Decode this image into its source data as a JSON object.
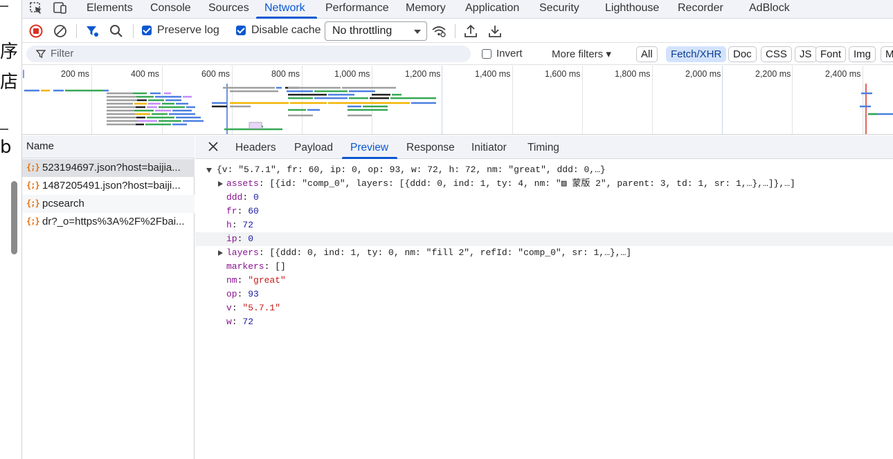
{
  "main_tabs": [
    "Elements",
    "Console",
    "Sources",
    "Network",
    "Performance",
    "Memory",
    "Application",
    "Security",
    "Lighthouse",
    "Recorder",
    "AdBlock"
  ],
  "active_main_tab": "Network",
  "toolbar": {
    "preserve_log": "Preserve log",
    "disable_cache": "Disable cache",
    "throttling": "No throttling"
  },
  "filter": {
    "placeholder": "Filter",
    "invert": "Invert",
    "more_filters": "More filters ▾",
    "types": [
      "All",
      "Fetch/XHR",
      "Doc",
      "CSS",
      "JS",
      "Font",
      "Img",
      "M"
    ],
    "active_type": "Fetch/XHR"
  },
  "timeline": {
    "ticks": [
      "200 ms",
      "400 ms",
      "600 ms",
      "800 ms",
      "1,000 ms",
      "1,200 ms",
      "1,400 ms",
      "1,600 ms",
      "1,800 ms",
      "2,000 ms",
      "2,200 ms",
      "2,400 ms"
    ]
  },
  "requests": {
    "header": "Name",
    "icon_glyph": "{;}",
    "items": [
      "523194697.json?host=baijia...",
      "1487205491.json?host=baiji...",
      "pcsearch",
      "dr?_o=https%3A%2F%2Fbai..."
    ]
  },
  "detail_tabs": [
    "Headers",
    "Payload",
    "Preview",
    "Response",
    "Initiator",
    "Timing"
  ],
  "active_detail_tab": "Preview",
  "preview": {
    "root_summary": "{v: \"5.7.1\", fr: 60, ip: 0, op: 93, w: 72, h: 72, nm: \"great\", ddd: 0,…}",
    "rows": [
      {
        "key": "assets",
        "value": "[{id: \"comp_0\", layers: [{ddd: 0, ind: 1, ty: 4, nm: \"▨ 蒙版 2\", parent: 3, td: 1, sr: 1,…},…]},…]",
        "kind": "obj",
        "expandable": true
      },
      {
        "key": "ddd",
        "value": "0",
        "kind": "num",
        "expandable": false
      },
      {
        "key": "fr",
        "value": "60",
        "kind": "num",
        "expandable": false
      },
      {
        "key": "h",
        "value": "72",
        "kind": "num",
        "expandable": false
      },
      {
        "key": "ip",
        "value": "0",
        "kind": "num",
        "expandable": false,
        "highlight": true
      },
      {
        "key": "layers",
        "value": "[{ddd: 0, ind: 1, ty: 0, nm: \"fill 2\", refId: \"comp_0\", sr: 1,…},…]",
        "kind": "obj",
        "expandable": true
      },
      {
        "key": "markers",
        "value": "[]",
        "kind": "obj",
        "expandable": false
      },
      {
        "key": "nm",
        "value": "\"great\"",
        "kind": "str",
        "expandable": false
      },
      {
        "key": "op",
        "value": "93",
        "kind": "num",
        "expandable": false
      },
      {
        "key": "v",
        "value": "\"5.7.1\"",
        "kind": "str",
        "expandable": false
      },
      {
        "key": "w",
        "value": "72",
        "kind": "num",
        "expandable": false
      }
    ]
  },
  "page_strip": {
    "glyphs": [
      "序",
      "店",
      "b"
    ]
  },
  "colors": {
    "accent": "#0b57d0",
    "record_red": "#d93025",
    "json_key": "#881391",
    "json_number": "#1a1aa6",
    "json_string": "#c41a16",
    "request_icon": "#e8710a"
  }
}
